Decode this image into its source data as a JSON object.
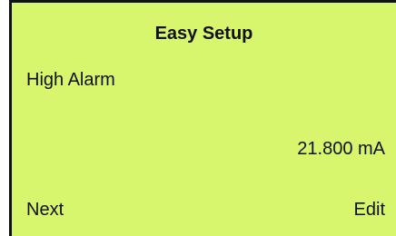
{
  "screen": {
    "title": "Easy Setup",
    "parameter_name": "High Alarm",
    "value": "21.800 mA"
  },
  "softkeys": {
    "left": "Next",
    "right": "Edit"
  },
  "colors": {
    "lcd_background": "#d7f56d",
    "text": "#111111",
    "frame": "#111111"
  }
}
